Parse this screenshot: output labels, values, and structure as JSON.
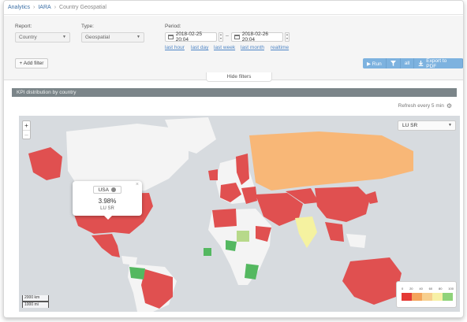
{
  "breadcrumb": {
    "items": [
      "Analytics",
      "IARA",
      "Country Geospatial"
    ]
  },
  "filters": {
    "report_label": "Report:",
    "report_value": "Country",
    "type_label": "Type:",
    "type_value": "Geospatial",
    "period_label": "Period:",
    "period_from": "2018-02-25 20:04",
    "period_to": "2018-02-26 20:04",
    "period_separator": "–",
    "quick_links": [
      "last hour",
      "last day",
      "last week",
      "last month",
      "realtime"
    ],
    "add_filter_label": "+ Add filter",
    "hide_filters_label": "Hide filters"
  },
  "actions": {
    "run_label": "▶ Run",
    "filter_icon": "filter-icon",
    "all_label": "all",
    "export_label": "Export to PDF"
  },
  "section": {
    "title": "KPI distribution by country"
  },
  "refresh": {
    "label": "Refresh every 5 min"
  },
  "map": {
    "kpi_selected": "LU SR",
    "zoom_in": "+",
    "zoom_out": "–",
    "scale_km": "2000 km",
    "scale_mi": "1000 mi",
    "popup": {
      "country": "USA",
      "value": "3.98%",
      "kpi": "LU SR"
    },
    "legend": {
      "ticks": [
        "0",
        "20",
        "40",
        "60",
        "80",
        "100"
      ],
      "colors": [
        "#e53935",
        "#f4a45b",
        "#f7cf8e",
        "#f7f0a6",
        "#8fd37a",
        "#2e9e3b"
      ]
    },
    "colors": {
      "red": "#e05050",
      "orange": "#f8b777",
      "green": "#54b860",
      "lightgreen": "#b7d98a",
      "yellow": "#f5f2a0",
      "land": "#f4f4f4",
      "water": "#d7dbdf"
    }
  },
  "colors": {
    "accent": "#7db2df",
    "link": "#4f86c6",
    "section": "#7b8589"
  }
}
